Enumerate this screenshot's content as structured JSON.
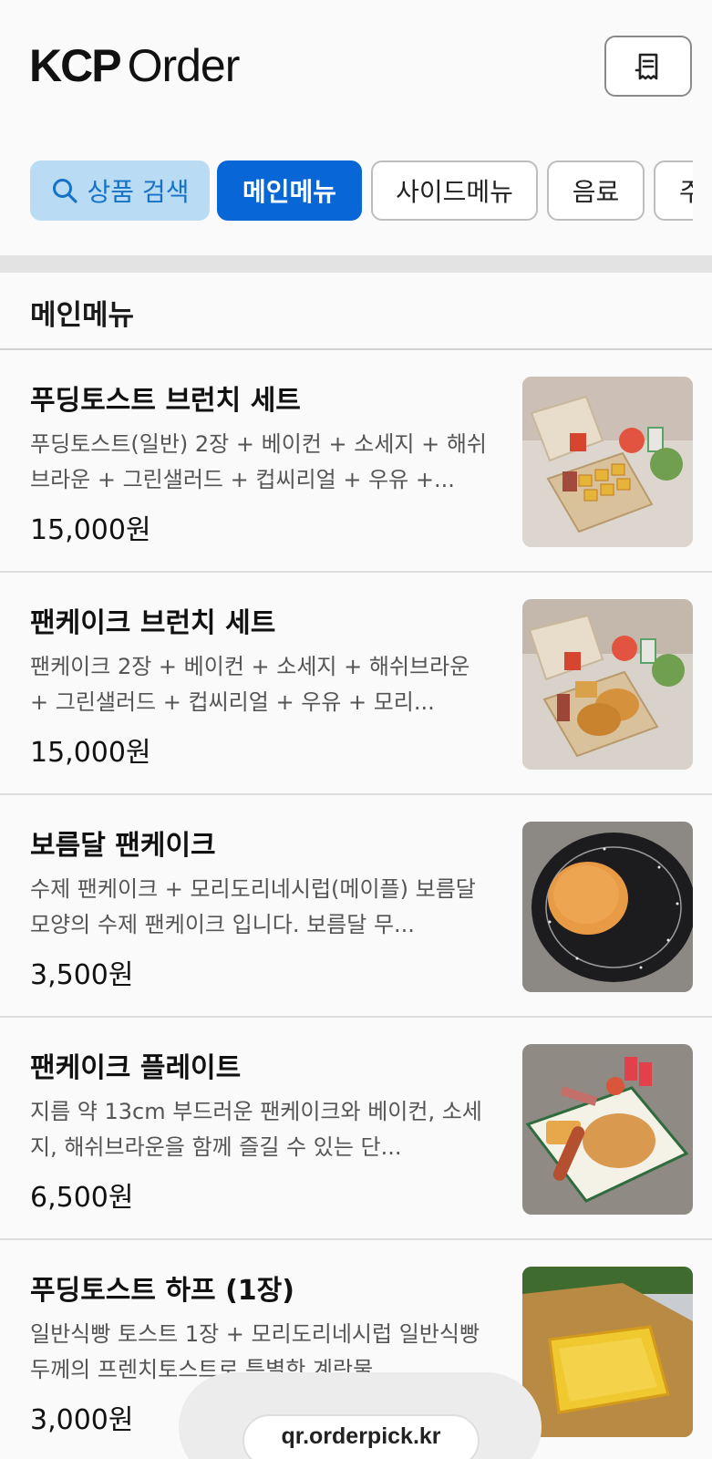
{
  "header": {
    "logo_brand": "KCP",
    "logo_rest": "Order",
    "receipt_icon": "receipt-icon"
  },
  "tabs": [
    {
      "label": "상품 검색",
      "icon": "search-icon",
      "state": "search"
    },
    {
      "label": "메인메뉴",
      "state": "active"
    },
    {
      "label": "사이드메뉴",
      "state": "default"
    },
    {
      "label": "음료",
      "state": "default"
    },
    {
      "label": "주",
      "state": "default"
    }
  ],
  "section": {
    "title": "메인메뉴"
  },
  "items": [
    {
      "name": "푸딩토스트 브런치 세트",
      "desc": "푸딩토스트(일반) 2장 + 베이컨 + 소세지 + 해쉬브라운 + 그린샐러드 + 컵씨리얼 + 우유 +...",
      "price": "15,000원",
      "thumb": "brunch-box-toast"
    },
    {
      "name": "팬케이크 브런치 세트",
      "desc": "팬케이크 2장 + 베이컨 + 소세지 + 해쉬브라운 + 그린샐러드 + 컵씨리얼 + 우유 + 모리...",
      "price": "15,000원",
      "thumb": "brunch-box-pancake"
    },
    {
      "name": "보름달 팬케이크",
      "desc": "수제 팬케이크 + 모리도리네시럽(메이플) 보름달 모양의 수제 팬케이크 입니다. 보름달 무...",
      "price": "3,500원",
      "thumb": "pancake-plate"
    },
    {
      "name": "팬케이크 플레이트",
      "desc": "지름 약 13cm 부드러운 팬케이크와 베이컨, 소세지, 해쉬브라운을 함께 즐길 수 있는 단...",
      "price": "6,500원",
      "thumb": "pancake-platter"
    },
    {
      "name": "푸딩토스트 하프 (1장)",
      "desc": "일반식빵 토스트 1장 + 모리도리네시럽 일반식빵 두께의 프렌치토스트로 특별한 계란물...",
      "price": "3,000원",
      "thumb": "toast-half"
    }
  ],
  "footer": {
    "url": "qr.orderpick.kr"
  },
  "colors": {
    "accent": "#0866d6",
    "search_bg": "#b9dcf4",
    "search_text": "#1672c6"
  }
}
